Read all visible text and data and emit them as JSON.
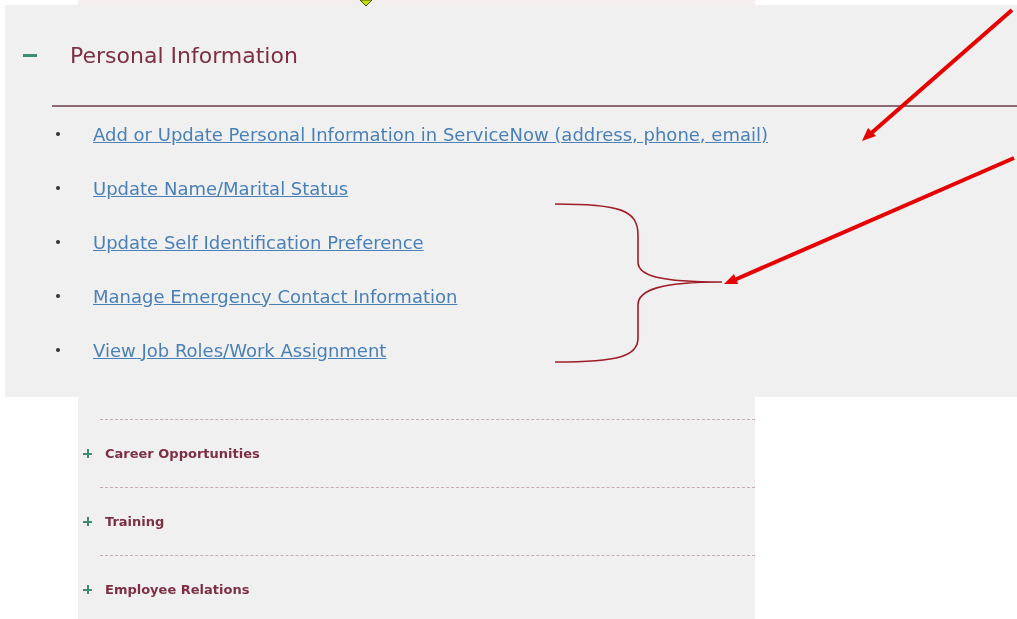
{
  "open_section": {
    "title": "Personal Information",
    "expanded": true,
    "links": [
      "Add or Update Personal Information in ServiceNow (address, phone, email)",
      "Update Name/Marital Status",
      "Update Self Identification Preference",
      "Manage Emergency Contact Information",
      "View Job Roles/Work Assignment"
    ]
  },
  "sections": [
    {
      "title": "Career Opportunities",
      "expanded": false
    },
    {
      "title": "Training",
      "expanded": false
    },
    {
      "title": "Employee Relations",
      "expanded": false
    }
  ]
}
